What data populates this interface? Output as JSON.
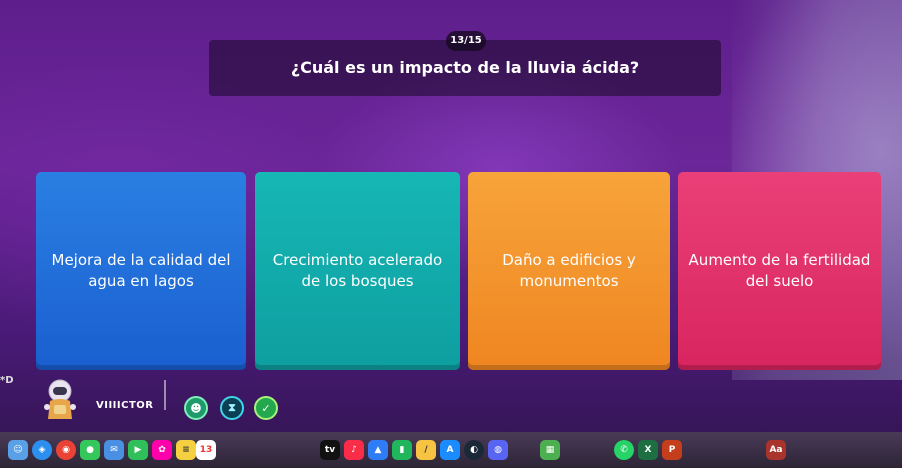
{
  "quiz": {
    "counter": "13/15",
    "question": "¿Cuál es un impacto de la lluvia ácida?",
    "options": [
      {
        "label": "Mejora de la calidad del agua en lagos",
        "color": "#2169d9"
      },
      {
        "label": "Crecimiento acelerado de los bosques",
        "color": "#13aeae"
      },
      {
        "label": "Daño a edificios y monumentos",
        "color": "#f3952c"
      },
      {
        "label": "Aumento de la fertilidad del suelo",
        "color": "#e2356d"
      }
    ]
  },
  "player": {
    "name": "VIIIICTOR",
    "avatar": "astronaut-avatar-icon",
    "powerups": [
      "mask-powerup-icon",
      "hourglass-powerup-icon",
      "shield-powerup-icon"
    ]
  },
  "edge_text": "*D",
  "dock": {
    "calendar_day": "13",
    "apps": [
      "finder",
      "safari",
      "chrome",
      "messages",
      "mail",
      "facetime",
      "photos",
      "notes",
      "calendar",
      "music",
      "appletv",
      "keynote",
      "numbers",
      "freeform",
      "appstore",
      "steam",
      "discord",
      "minecraft",
      "whatsapp",
      "excel",
      "powerpoint",
      "dictionary"
    ],
    "dictionary_label": "Aa"
  }
}
